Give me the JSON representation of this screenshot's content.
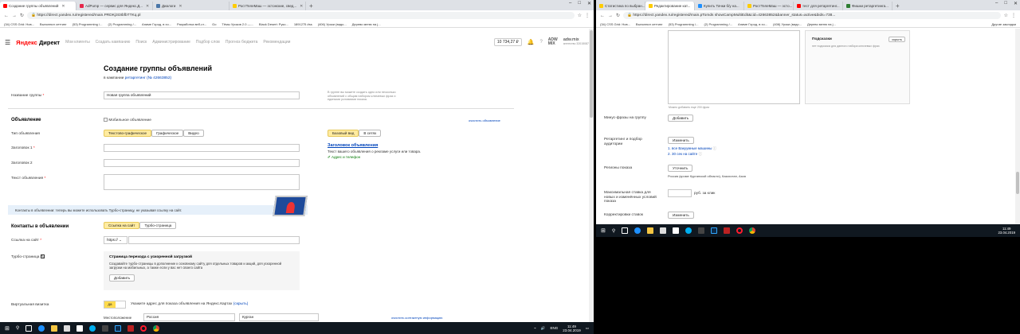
{
  "left": {
    "tabs": [
      {
        "label": "Создание группы объявлений",
        "color": "#ff0000",
        "active": true
      },
      {
        "label": "AdPump — сервис для Яндекс.Д...",
        "color": "#e6274a"
      },
      {
        "label": "Диалоги",
        "color": "#4a76a8"
      },
      {
        "label": "РостТелеМаш — эстонские, свед...",
        "color": "#ffcc00"
      }
    ],
    "new_tab": "+",
    "window_controls": [
      "–",
      "□",
      "✕"
    ],
    "url": "https://direct.yandex.ru/registered/main.PRDKj3I3IbfbTTKq.pl",
    "bookmarks": [
      "(34) CSS Grid: Нов...",
      "Выполнил сеттинг",
      "(53) Programming /...",
      "(2) Programming /...",
      "Аниме Город, в хо...",
      "Разработка веб-ст...",
      "Go",
      "Тёмы Уроков 2.0 —...",
      "Black Desert: Руко...",
      "1891275 #ss",
      "(406) Уроки (видо...",
      "Дерево меню на j..."
    ],
    "logo": "Директ",
    "logo_brand": "Яндекс",
    "nav": [
      "Мои клиенты",
      "Создать кампанию",
      "Поиск",
      "Администрирование",
      "Подбор слов",
      "Прогноз бюджета",
      "Рекомендации"
    ],
    "balance": "10 734,27 ₽",
    "user": "adw.mix",
    "user_sub": "агентство 32015087",
    "page_title": "Создание группы объявлений",
    "campaign_prefix": "в кампании",
    "campaign_link": "ретаргетинг (№ 42663852)",
    "group_name_label": "Название группы",
    "group_name_value": "Новая группа объявлений",
    "group_hint": "В группе вы можете создать одно или несколько объявлений с общим набором ключевых фраз и едиными условиями показа.",
    "ad_section": "Объявление",
    "mobile_ad": "Мобильное объявление",
    "clear_ad": "очистить объявление",
    "ad_type_label": "Тип объявления",
    "ad_types": [
      "Текстово-графическое",
      "Графическое",
      "Видео"
    ],
    "preview_tabs": [
      "Базовый вид",
      "В сетях"
    ],
    "title1_label": "Заголовок 1",
    "title2_label": "Заголовок 2",
    "text_label": "Текст объявления",
    "preview_title": "Заголовок объявления",
    "preview_text": "Текст вашего объявления о рекламе услуги или товара.",
    "preview_addr": "Адрес и телефон",
    "contacts_promo": "Контакты в объявлении: теперь вы можете использовать Турбо-страницу, не указывая ссылку на сайт.",
    "contacts_section": "Контакты в объявлении",
    "contact_tabs": [
      "Ссылка на сайт",
      "Турбо-страница"
    ],
    "site_link_label": "Ссылка на сайт",
    "protocol": "https://",
    "turbo_label": "Турбо-страница",
    "turbo_title": "Страница перехода с ускоренной загрузкой",
    "turbo_text": "Создавайте турбо-страницы в дополнение к основному сайту для отдельных товаров и акций, для ускоренной загрузки на мобильных, а также если у вас нет своего сайта",
    "add_btn": "Добавить",
    "vcard_label": "Виртуальная визитка",
    "toggle_yes": "да",
    "vcard_hint": "Укажите адрес для показа объявления на Яндекс.Картах",
    "vcard_hide": "(скрыть)",
    "location_label": "Местоположение",
    "country": "Россия",
    "city": "Курган",
    "clear_contact": "очистить контактную информацию"
  },
  "right": {
    "tabs": [
      {
        "label": "Статистика по выбран...",
        "color": "#ffcc00"
      },
      {
        "label": "Редактирование кат...",
        "color": "#ffcc00",
        "active": true
      },
      {
        "label": "Купить Тачки б/у на...",
        "color": "#1e90ff"
      },
      {
        "label": "РостТелеМаш — эсто...",
        "color": "#ffcc00"
      },
      {
        "label": "тест для ретаргетинг...",
        "color": "#ff0000"
      },
      {
        "label": "Фишки ретаргетинга...",
        "color": "#2e7d32"
      }
    ],
    "new_tab": "+",
    "window_controls": [
      "–",
      "□",
      "✕"
    ],
    "url": "https://direct.yandex.ru/registered/main.pTomds showCampMultiEdit&cid=42663852&banner_status=active&bids=738...",
    "bookmarks": [
      "(34) CSS Grid: Нов...",
      "Выполнил сеттинг",
      "(53) Programming /...",
      "(2) Programming /...",
      "Аниме Город, в хо...",
      "(406) Уроки (видо...",
      "Дерево меню на j..."
    ],
    "other_bookmarks": "Другие закладки",
    "hints_title": "Подсказки",
    "hints_hide": "скрыть",
    "hints_text": "нет подсказок для данного набора ключевых фраз",
    "phrases_counter": "Можно добавить еще 200 фраз",
    "minus_label": "Минус-фразы на группу",
    "add_btn": "Добавить",
    "retarget_label": "Ретаргетинг и подбор аудитории",
    "change_btn": "Изменить",
    "retarget_items": [
      "1. все Вакуумные машины",
      "2. 30 сек на сайте"
    ],
    "regions_label": "Регионы показа",
    "refine_btn": "Уточнить",
    "regions_value": "Россия (кроме Курганской области), Казахстан, Азия",
    "maxbid_label": "Максимальная ставка для новых и изменённых условий показа",
    "maxbid_unit": "руб. за клик",
    "bidadj_label": "Корректировки ставок",
    "bidadj_btn": "Изменить"
  },
  "taskbar_left": {
    "lang": "ENG",
    "time": "11:49",
    "date": "23.04.2019"
  },
  "taskbar_right": {
    "time": "11:49",
    "date": "23.04.2019"
  }
}
